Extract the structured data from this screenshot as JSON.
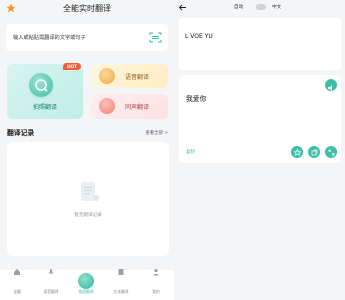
{
  "left": {
    "title": "全能实时翻译",
    "input_placeholder": "输入或粘贴需翻译的文字或句子",
    "cards": {
      "photo": {
        "label": "拍照翻译",
        "badge": "HOT"
      },
      "voice": {
        "label": "语音翻译"
      },
      "simul": {
        "label": "同声翻译"
      }
    },
    "history": {
      "title": "翻译记录",
      "more": "查看全部 >",
      "empty": "暂无翻译记录"
    },
    "tabs": [
      {
        "label": "全翻",
        "icon": "home-icon",
        "active": false
      },
      {
        "label": "语音翻译",
        "icon": "voice-icon",
        "active": false
      },
      {
        "label": "拍照翻译",
        "icon": "camera-icon",
        "active": true
      },
      {
        "label": "文本翻译",
        "icon": "document-icon",
        "active": false
      },
      {
        "label": "我的",
        "icon": "user-icon",
        "active": false
      }
    ],
    "accent": "#3dbfa6"
  },
  "right": {
    "src_lang": "自动",
    "dst_lang": "中文",
    "source_text": "L VOE YU",
    "output_text": "我爱你",
    "copy_label": "复制",
    "accent": "#3dbfa6"
  }
}
